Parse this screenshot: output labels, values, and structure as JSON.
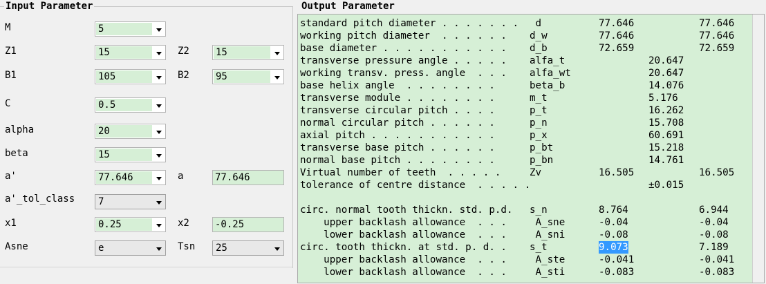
{
  "input": {
    "title": "Input Parameter",
    "fields": {
      "M": {
        "label": "M",
        "value": "5"
      },
      "Z1": {
        "label": "Z1",
        "value": "15"
      },
      "Z2": {
        "label": "Z2",
        "value": "15"
      },
      "B1": {
        "label": "B1",
        "value": "105"
      },
      "B2": {
        "label": "B2",
        "value": "95"
      },
      "C": {
        "label": "C",
        "value": "0.5"
      },
      "alpha": {
        "label": "alpha",
        "value": "20"
      },
      "beta": {
        "label": "beta",
        "value": "15"
      },
      "a_prime": {
        "label": "a'",
        "value": "77.646"
      },
      "a": {
        "label": "a",
        "value": "77.646"
      },
      "a_tol_class": {
        "label": "a'_tol_class",
        "value": "7"
      },
      "x1": {
        "label": "x1",
        "value": "0.25"
      },
      "x2": {
        "label": "x2",
        "value": "-0.25"
      },
      "Asne": {
        "label": "Asne",
        "value": "e"
      },
      "Tsn": {
        "label": "Tsn",
        "value": "25"
      }
    }
  },
  "output": {
    "title": "Output Parameter",
    "rows": [
      {
        "desc": "standard pitch diameter . . . . . . .",
        "sym": " d",
        "v1": "77.646",
        "v2": "",
        "v3": "77.646"
      },
      {
        "desc": "working pitch diameter  . . . . . .",
        "sym": "d_w",
        "v1": "77.646",
        "v2": "",
        "v3": "77.646"
      },
      {
        "desc": "base diameter . . . . . . . . . . .",
        "sym": "d_b",
        "v1": "72.659",
        "v2": "",
        "v3": "72.659"
      },
      {
        "desc": "transverse pressure angle . . . . .",
        "sym": "alfa_t",
        "v1": "",
        "v2": "20.647",
        "v3": ""
      },
      {
        "desc": "working transv. press. angle  . . .",
        "sym": "alfa_wt",
        "v1": "",
        "v2": "20.647",
        "v3": ""
      },
      {
        "desc": "base helix angle  . . . . . . . .",
        "sym": "beta_b",
        "v1": "",
        "v2": "14.076",
        "v3": ""
      },
      {
        "desc": "transverse module . . . . . . . .",
        "sym": "m_t",
        "v1": "",
        "v2": "5.176",
        "v3": ""
      },
      {
        "desc": "transverse circular pitch . . . .",
        "sym": "p_t",
        "v1": "",
        "v2": "16.262",
        "v3": ""
      },
      {
        "desc": "normal circular pitch . . . . . .",
        "sym": "p_n",
        "v1": "",
        "v2": "15.708",
        "v3": ""
      },
      {
        "desc": "axial pitch . . . . . . . . . . .",
        "sym": "p_x",
        "v1": "",
        "v2": "60.691",
        "v3": ""
      },
      {
        "desc": "transverse base pitch . . . . . .",
        "sym": "p_bt",
        "v1": "",
        "v2": "15.218",
        "v3": ""
      },
      {
        "desc": "normal base pitch . . . . . . . .",
        "sym": "p_bn",
        "v1": "",
        "v2": "14.761",
        "v3": ""
      },
      {
        "desc": "Virtual number of teeth  . . . . .",
        "sym": "Zv",
        "v1": "16.505",
        "v2": "",
        "v3": "16.505"
      },
      {
        "desc": "tolerance of centre distance  . . . . .",
        "sym": "",
        "v1": "",
        "v2": "±0.015",
        "v3": ""
      },
      {
        "desc": "",
        "sym": "",
        "v1": "",
        "v2": "",
        "v3": ""
      },
      {
        "desc": "circ. normal tooth thickn. std. p.d.",
        "sym": "s_n",
        "v1": "8.764",
        "v2": "",
        "v3": "6.944"
      },
      {
        "desc": "    upper backlash allowance  . . .",
        "sym": " A_sne",
        "v1": "-0.04",
        "v2": "",
        "v3": "-0.04"
      },
      {
        "desc": "    lower backlash allowance  . . .",
        "sym": " A_sni",
        "v1": "-0.08",
        "v2": "",
        "v3": "-0.08"
      },
      {
        "desc": "circ. tooth thickn. at std. p. d. .",
        "sym": "s_t",
        "v1": "9.073",
        "v2": "",
        "v3": "7.189"
      },
      {
        "desc": "    upper backlash allowance  . . .",
        "sym": " A_ste",
        "v1": "-0.041",
        "v2": "",
        "v3": "-0.041"
      },
      {
        "desc": "    lower backlash allowance  . . .",
        "sym": " A_sti",
        "v1": "-0.083",
        "v2": "",
        "v3": "-0.083"
      }
    ],
    "selected_row": 18
  }
}
